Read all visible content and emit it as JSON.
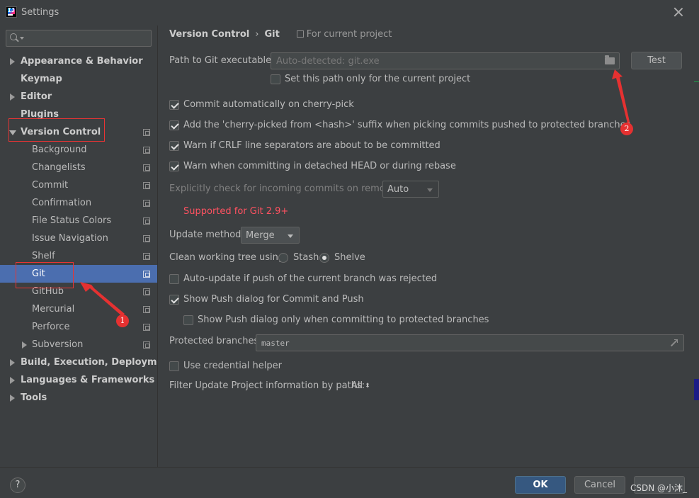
{
  "window": {
    "title": "Settings"
  },
  "sidebar": {
    "search_placeholder": "",
    "items": [
      {
        "label": "Appearance & Behavior",
        "arrow": "right"
      },
      {
        "label": "Keymap",
        "arrow": "none"
      },
      {
        "label": "Editor",
        "arrow": "right"
      },
      {
        "label": "Plugins",
        "arrow": "none"
      },
      {
        "label": "Version Control",
        "arrow": "down"
      },
      {
        "label": "Background"
      },
      {
        "label": "Changelists"
      },
      {
        "label": "Commit"
      },
      {
        "label": "Confirmation"
      },
      {
        "label": "File Status Colors"
      },
      {
        "label": "Issue Navigation"
      },
      {
        "label": "Shelf"
      },
      {
        "label": "Git"
      },
      {
        "label": "GitHub"
      },
      {
        "label": "Mercurial"
      },
      {
        "label": "Perforce"
      },
      {
        "label": "Subversion",
        "arrow": "right"
      },
      {
        "label": "Build, Execution, Deployment",
        "arrow": "right"
      },
      {
        "label": "Languages & Frameworks",
        "arrow": "right"
      },
      {
        "label": "Tools",
        "arrow": "right"
      }
    ]
  },
  "breadcrumb": {
    "parent": "Version Control",
    "separator": "›",
    "current": "Git",
    "scope": "For current project"
  },
  "git": {
    "path_label": "Path to Git executable:",
    "path_placeholder": "Auto-detected: git.exe",
    "test_button": "Test",
    "current_project_only": "Set this path only for the current project",
    "commit_cherry_pick": "Commit automatically on cherry-pick",
    "add_suffix": "Add the 'cherry-picked from <hash>' suffix when picking commits pushed to protected branches",
    "warn_crlf": "Warn if CRLF line separators are about to be committed",
    "warn_detached": "Warn when committing in detached HEAD or during rebase",
    "explicit_check_label": "Explicitly check for incoming commits on remotes:",
    "explicit_check_value": "Auto",
    "supported_note": "Supported for Git 2.9+",
    "update_method_label": "Update method:",
    "update_method_value": "Merge",
    "clean_tree_label": "Clean working tree using:",
    "stash_label": "Stash",
    "shelve_label": "Shelve",
    "auto_update": "Auto-update if push of the current branch was rejected",
    "show_push_dialog": "Show Push dialog for Commit and Push",
    "show_push_protected": "Show Push dialog only when committing to protected branches",
    "protected_label": "Protected branches:",
    "protected_value": "master",
    "credential_helper": "Use credential helper",
    "filter_label": "Filter Update Project information by paths:",
    "filter_value": "All"
  },
  "checkbox_states": {
    "current_project_only": false,
    "commit_cherry_pick": true,
    "add_suffix": true,
    "warn_crlf": true,
    "warn_detached": true,
    "auto_update": false,
    "show_push_dialog": true,
    "show_push_protected": false,
    "credential_helper": false
  },
  "footer": {
    "help": "?",
    "ok": "OK",
    "cancel": "Cancel",
    "watermark": "CSDN @小沐_"
  },
  "annotations": {
    "badge1": "1",
    "badge2": "2"
  },
  "colors": {
    "accent": "#4b6eaf",
    "ok_button": "#365880",
    "warning_text": "#ff5261",
    "annotation": "#e83434"
  },
  "icons": {
    "search": "search-icon",
    "close": "close-icon",
    "folder": "folder-icon",
    "expand": "expand-icon",
    "help": "help-icon",
    "project_scope": "project-scope-icon"
  }
}
